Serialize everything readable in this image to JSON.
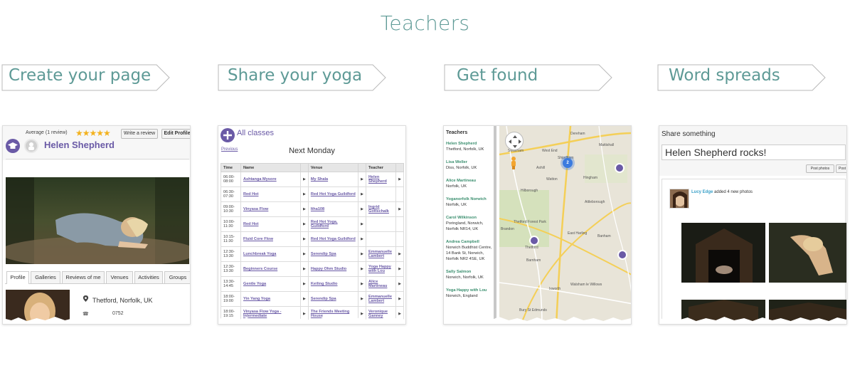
{
  "page": {
    "title": "Teachers"
  },
  "colors": {
    "accent": "#5e9a96",
    "link": "#6a5aa6",
    "star": "#f3b21e"
  },
  "steps": [
    {
      "label": "Create your page"
    },
    {
      "label": "Share your yoga"
    },
    {
      "label": "Get found"
    },
    {
      "label": "Word spreads"
    }
  ],
  "profile_card": {
    "average_label": "Average (1 review)",
    "rating": 5,
    "stars": "★★★★★",
    "write_review_label": "Write a review",
    "edit_profile_label": "Edit Profile",
    "name": "Helen Shepherd",
    "tabs": [
      "Profile",
      "Galleries",
      "Reviews of me",
      "Venues",
      "Activities",
      "Groups"
    ],
    "location": "Thetford, Norfolk, UK",
    "phone_partial": "0752"
  },
  "classes_card": {
    "heading": "All classes",
    "previous_label": "Previous",
    "day_label": "Next Monday",
    "columns": [
      "Time",
      "Name",
      "Venue",
      "Teacher"
    ],
    "rows": [
      {
        "time": "06:00-08:00",
        "name": "Ashtanga Mysore",
        "venue": "My Shala",
        "teacher": "Helen Shepherd"
      },
      {
        "time": "06:30-07:30",
        "name": "Red Hot",
        "venue": "Red Hot Yoga Guildford",
        "teacher": ""
      },
      {
        "time": "09:00-10:30",
        "name": "Vinyasa Flow",
        "venue": "Itha108",
        "teacher": "Ingrid Gottschalk"
      },
      {
        "time": "10:00-11:30",
        "name": "Red Hot",
        "venue": "Red Hot Yoga, Guildford",
        "teacher": ""
      },
      {
        "time": "10:15-11:30",
        "name": "Fluid Core Flow",
        "venue": "Red Hot Yoga Guildford",
        "teacher": ""
      },
      {
        "time": "12:30-13:30",
        "name": "Lunchbreak Yoga",
        "venue": "Serendip Spa",
        "teacher": "Emmanuelle Lambert"
      },
      {
        "time": "12:30-13:30",
        "name": "Beginners Course",
        "venue": "Happy Ohm Studio",
        "teacher": "Yoga Happy with Lou"
      },
      {
        "time": "13:30-14:45",
        "name": "Gentle Yoga",
        "venue": "Keiling Studio",
        "teacher": "Alice Martineau"
      },
      {
        "time": "18:00-19:00",
        "name": "Yin Yang Yoga",
        "venue": "Serendip Spa",
        "teacher": "Emmanuelle Lambert"
      },
      {
        "time": "18:00-19:15",
        "name": "Vinyasa Flow Yoga - Intermediate",
        "venue": "The Friends Meeting House",
        "teacher": "Veronique Ganney"
      }
    ]
  },
  "map_card": {
    "list_title": "Teachers",
    "teachers": [
      {
        "name": "Helen Shepherd",
        "address": "Thetford, Norfolk, UK"
      },
      {
        "name": "Lisa Weller",
        "address": "Diss, Norfolk, UK"
      },
      {
        "name": "Alice Martineau",
        "address": "Norfolk, UK"
      },
      {
        "name": "Yoganorfolk Norwich",
        "address": "Norfolk, UK"
      },
      {
        "name": "Carol Wilkinson",
        "address": "Poringland, Norwich, Norfolk NR14, UK"
      },
      {
        "name": "Andrea Campbell",
        "address": "Norwich Buddhist Centre, 14 Bank St, Norwich, Norfolk NR2 4SE, UK"
      },
      {
        "name": "Sally Salmon",
        "address": "Norwich, Norfolk, UK"
      },
      {
        "name": "Yoga Happy with Lou",
        "address": "Norwich, England"
      }
    ],
    "cluster_count": "2",
    "places": [
      "Dereham",
      "Mattishall",
      "Swaffham",
      "West End",
      "Shipdham",
      "Ashill",
      "Hingham",
      "Hilborough",
      "Watton",
      "Attleborough",
      "Brandon",
      "Thetford Forest Park",
      "East Harling",
      "Banham",
      "Thetford",
      "Barnham",
      "Ixworth",
      "Walsham le Willows",
      "Bury St Edmunds"
    ]
  },
  "share_card": {
    "heading": "Share something",
    "input_value": "Helen Shepherd rocks!",
    "post_photos_label": "Post photos",
    "post_label": "Post",
    "author": "Lucy Edge",
    "activity": "added 4 new photos"
  }
}
